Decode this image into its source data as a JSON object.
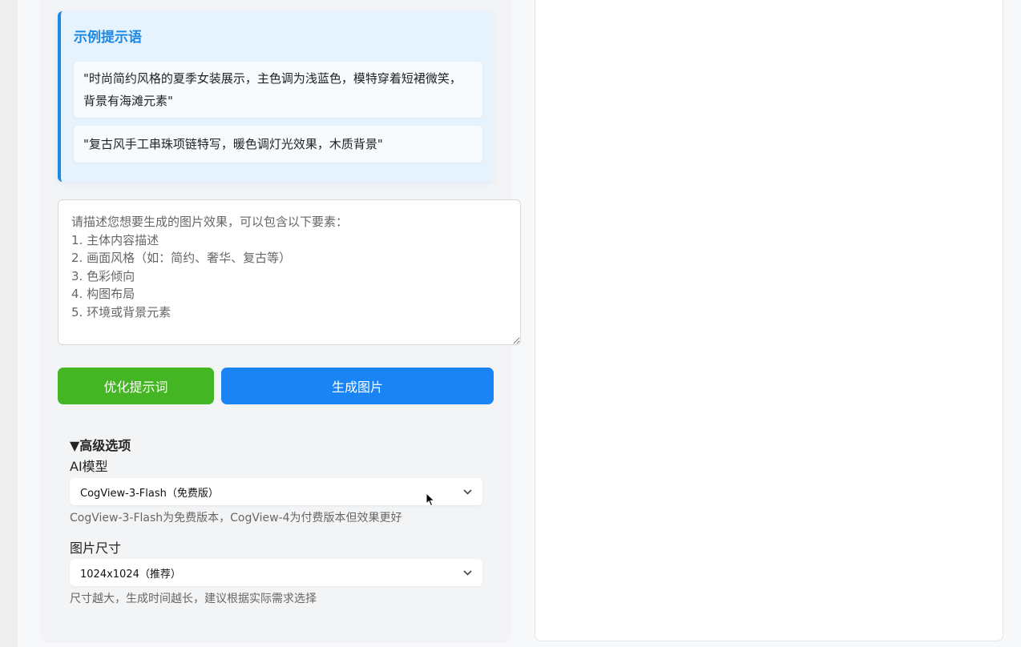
{
  "examples": {
    "title": "示例提示语",
    "items": [
      "\"时尚简约风格的夏季女装展示，主色调为浅蓝色，模特穿着短裙微笑，背景有海滩元素\"",
      "\"复古风手工串珠项链特写，暖色调灯光效果，木质背景\""
    ]
  },
  "prompt": {
    "value": "",
    "placeholder": "请描述您想要生成的图片效果，可以包含以下要素：\n1. 主体内容描述\n2. 画面风格（如：简约、奢华、复古等）\n3. 色彩倾向\n4. 构图布局\n5. 环境或背景元素"
  },
  "buttons": {
    "optimize_label": "优化提示词",
    "generate_label": "生成图片"
  },
  "advanced": {
    "summary": "▼高级选项",
    "model": {
      "label": "AI模型",
      "selected": "CogView-3-Flash（免费版）",
      "hint": "CogView-3-Flash为免费版本，CogView-4为付费版本但效果更好"
    },
    "size": {
      "label": "图片尺寸",
      "selected": "1024x1024（推荐）",
      "hint": "尺寸越大，生成时间越长，建议根据实际需求选择"
    }
  },
  "colors": {
    "accent_blue": "#1a84f5",
    "accent_green": "#44b624",
    "example_title": "#1e88e5"
  },
  "icons": {
    "chevron": "chevron-down-icon",
    "cursor": "mouse-pointer-icon"
  }
}
